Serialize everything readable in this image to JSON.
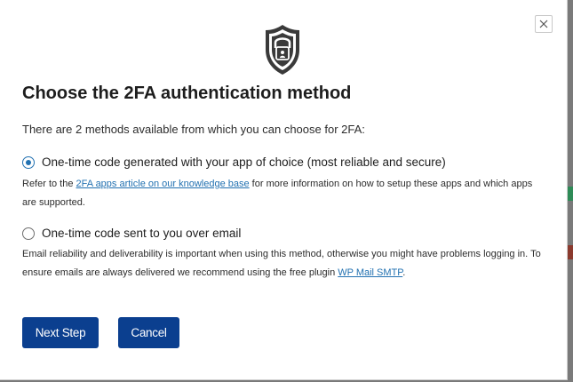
{
  "modal": {
    "close_symbol": "×",
    "icon": "shield-lock-icon",
    "title": "Choose the 2FA authentication method",
    "intro": "There are 2 methods available from which you can choose for 2FA:",
    "options": [
      {
        "label": "One-time code generated with your app of choice (most reliable and secure)",
        "selected": true,
        "desc_before": "Refer to the ",
        "link": "2FA apps article on our knowledge base",
        "desc_after": " for more information on how to setup these apps and which apps are supported."
      },
      {
        "label": "One-time code sent to you over email",
        "selected": false,
        "desc_before": "Email reliability and deliverability is important when using this method, otherwise you might have problems logging in. To ensure emails are always delivered we recommend using the free plugin ",
        "link": "WP Mail SMTP",
        "desc_after": "."
      }
    ],
    "next_label": "Next Step",
    "cancel_label": "Cancel"
  },
  "colors": {
    "primary_button": "#0b3f8f",
    "link": "#2271b1",
    "radio_selected": "#2271b1"
  }
}
